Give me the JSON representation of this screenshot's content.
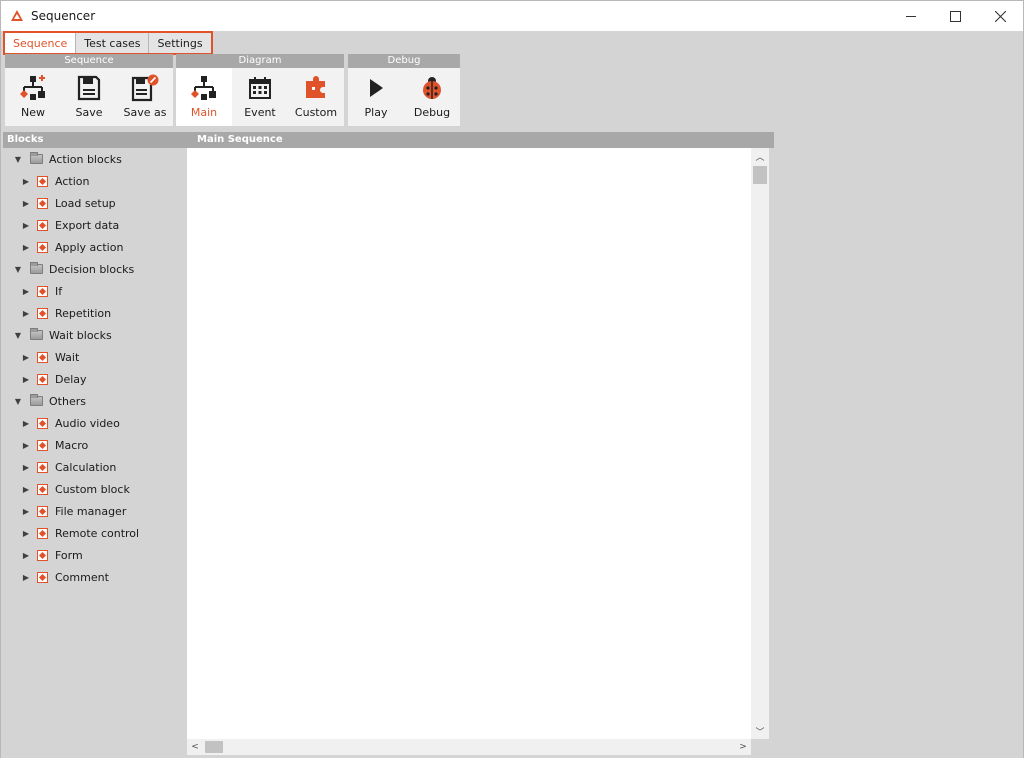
{
  "window": {
    "title": "Sequencer"
  },
  "tabs": [
    {
      "label": "Sequence",
      "active": true
    },
    {
      "label": "Test cases",
      "active": false
    },
    {
      "label": "Settings",
      "active": false
    }
  ],
  "ribbon": {
    "sequence": {
      "title": "Sequence",
      "items": [
        {
          "label": "New",
          "icon": "new-sequence-icon"
        },
        {
          "label": "Save",
          "icon": "floppy-disk-icon"
        },
        {
          "label": "Save as",
          "icon": "save-as-icon"
        }
      ]
    },
    "diagram": {
      "title": "Diagram",
      "items": [
        {
          "label": "Main",
          "icon": "flowchart-icon",
          "active": true
        },
        {
          "label": "Event",
          "icon": "calendar-icon"
        },
        {
          "label": "Custom",
          "icon": "puzzle-piece-icon"
        }
      ]
    },
    "debug": {
      "title": "Debug",
      "items": [
        {
          "label": "Play",
          "icon": "play-icon"
        },
        {
          "label": "Debug",
          "icon": "ladybug-icon"
        }
      ]
    }
  },
  "blocks": {
    "title": "Blocks",
    "groups": [
      {
        "label": "Action blocks",
        "items": [
          "Action",
          "Load setup",
          "Export data",
          "Apply action"
        ]
      },
      {
        "label": "Decision blocks",
        "items": [
          "If",
          "Repetition"
        ]
      },
      {
        "label": "Wait blocks",
        "items": [
          "Wait",
          "Delay"
        ]
      },
      {
        "label": "Others",
        "items": [
          "Audio video",
          "Macro",
          "Calculation",
          "Custom block",
          "File manager",
          "Remote control",
          "Form",
          "Comment"
        ]
      }
    ]
  },
  "main": {
    "title": "Main Sequence"
  },
  "colors": {
    "accent": "#e0532a",
    "header_gray": "#a8a8a8",
    "panel_bg": "#d4d4d4"
  }
}
